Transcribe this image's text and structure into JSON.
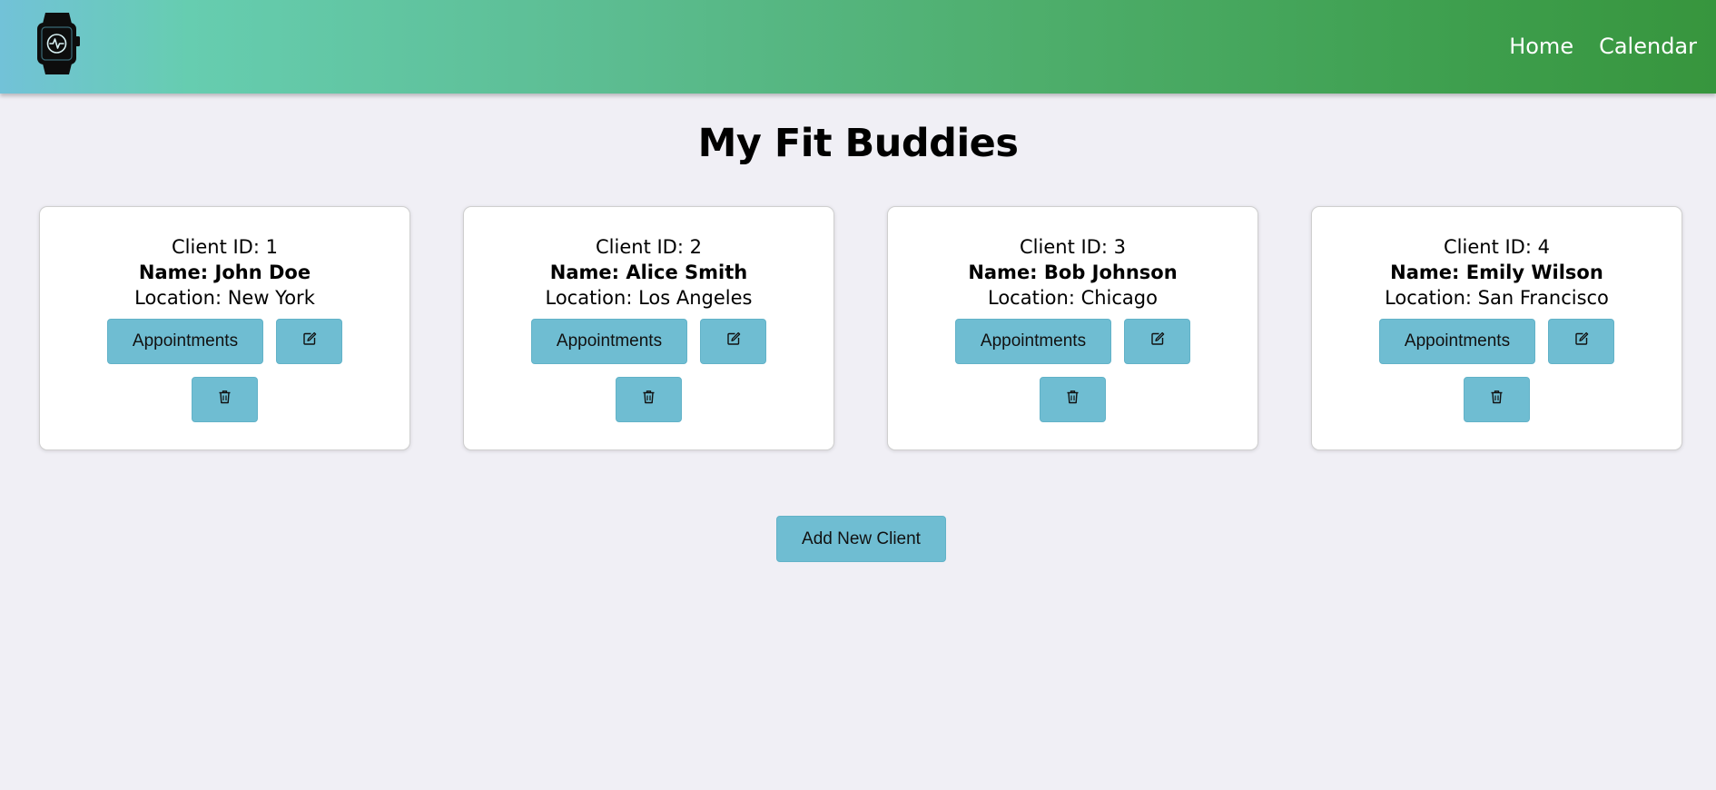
{
  "nav": {
    "logo_icon": "smartwatch-icon",
    "links": [
      {
        "label": "Home"
      },
      {
        "label": "Calendar"
      }
    ]
  },
  "page": {
    "title": "My Fit Buddies"
  },
  "clients": [
    {
      "id_text": "Client ID: 1",
      "name_text": "Name: John Doe",
      "location_text": "Location: New York",
      "appointments_label": "Appointments",
      "edit_icon": "edit-icon",
      "delete_icon": "trash-icon"
    },
    {
      "id_text": "Client ID: 2",
      "name_text": "Name: Alice Smith",
      "location_text": "Location: Los Angeles",
      "appointments_label": "Appointments",
      "edit_icon": "edit-icon",
      "delete_icon": "trash-icon"
    },
    {
      "id_text": "Client ID: 3",
      "name_text": "Name: Bob Johnson",
      "location_text": "Location: Chicago",
      "appointments_label": "Appointments",
      "edit_icon": "edit-icon",
      "delete_icon": "trash-icon"
    },
    {
      "id_text": "Client ID: 4",
      "name_text": "Name: Emily Wilson",
      "location_text": "Location: San Francisco",
      "appointments_label": "Appointments",
      "edit_icon": "edit-icon",
      "delete_icon": "trash-icon"
    }
  ],
  "actions": {
    "add_client_label": "Add New Client"
  },
  "colors": {
    "button": "#6fbdd2",
    "background": "#f0eff5",
    "nav_gradient_start": "#72c2d8",
    "nav_gradient_end": "#37953d"
  }
}
